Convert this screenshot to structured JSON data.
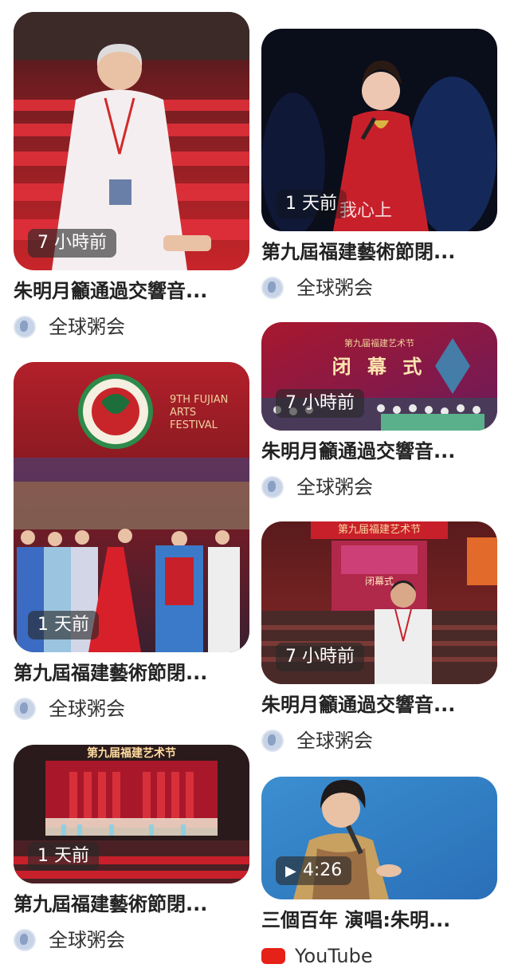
{
  "feed": {
    "items": [
      {
        "title": "朱明月籲通過交響音...",
        "source": "全球粥会",
        "time": "7 小時前"
      },
      {
        "title": "第九屆福建藝術節閉...",
        "source": "全球粥会",
        "time": "1 天前"
      },
      {
        "title": "朱明月籲通過交響音...",
        "source": "全球粥会",
        "time": "7 小時前"
      },
      {
        "title": "第九屆福建藝術節閉...",
        "source": "全球粥会",
        "time": "1 天前"
      },
      {
        "title": "朱明月籲通過交響音...",
        "source": "全球粥会",
        "time": "7 小時前"
      },
      {
        "title": "第九屆福建藝術節閉...",
        "source": "全球粥会",
        "time": "1 天前"
      },
      {
        "title": "三個百年 演唱:朱明...",
        "source": "YouTube",
        "duration": "4:26"
      }
    ],
    "thumb_texts": {
      "item2_caption": "我心上",
      "item3_banner_top": "第九届福建艺术节",
      "item3_banner_main": "闭 幕 式",
      "item4_logo_text": "9TH FUJIAN ARTS FESTIVAL",
      "item5_banner_top": "第九届福建艺术节",
      "item5_banner_main": "闭幕式",
      "item6_banner": "第九届福建艺术节"
    }
  }
}
